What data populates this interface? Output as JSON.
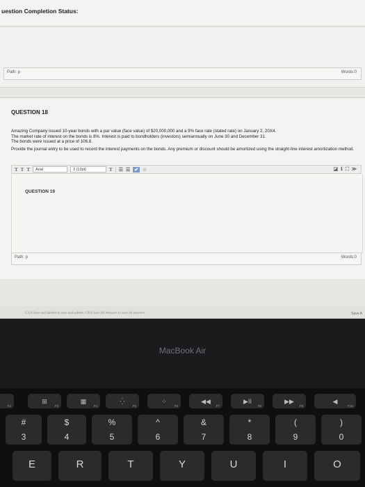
{
  "status": {
    "title": "uestion Completion Status:"
  },
  "editor1": {
    "path": "Path: p",
    "words": "Words:0"
  },
  "question18": {
    "title": "QUESTION 18",
    "body": [
      "Amazing Company issued 10-year bonds with a par value (face value) of $20,000,000 and a 9% face rate (stated rate) on January 2, 20X4.",
      "The market rate of interest on the bonds is 8%.  Interest is paid to bondholders (investors) semiannually on June 30 and December 31.",
      "The bonds were issued at a price of 106.8."
    ],
    "instruction": "Provide the journal entry to be used to record the interest payments on the bonds.  Any premium or discount should be amortized using the straight-line interest amortization method.",
    "toolbar": {
      "b1": "T",
      "b2": "T",
      "b3": "T",
      "font": "Arial",
      "size": "3 (12pt)",
      "t4": "T",
      "list1": "☰",
      "list2": "☰",
      "check": "✔",
      "link": "⊘",
      "right": [
        "◪",
        "ℹ",
        "⛶",
        "≫"
      ]
    },
    "path": "Path: p",
    "words": "Words:0"
  },
  "question19": {
    "title": "QUESTION 19"
  },
  "footer": {
    "hint": "Click Save and Submit to save and submit. Click Save All Answers to save all answers.",
    "save": "Save A"
  },
  "bezel": {
    "label": "MacBook Air"
  },
  "keyboard": {
    "fn_row": [
      {
        "icon": "",
        "fn": "F2"
      },
      {
        "icon": "⊞",
        "fn": "F3"
      },
      {
        "icon": "▦",
        "fn": "F4"
      },
      {
        "icon": "⁛",
        "fn": "F5"
      },
      {
        "icon": "⁘",
        "fn": "F6"
      },
      {
        "icon": "◀◀",
        "fn": "F7"
      },
      {
        "icon": "▶II",
        "fn": "F8"
      },
      {
        "icon": "▶▶",
        "fn": "F9"
      },
      {
        "icon": "◀",
        "fn": "F10"
      }
    ],
    "num_row": [
      {
        "top": "#",
        "bot": "3"
      },
      {
        "top": "$",
        "bot": "4"
      },
      {
        "top": "%",
        "bot": "5"
      },
      {
        "top": "^",
        "bot": "6"
      },
      {
        "top": "&",
        "bot": "7"
      },
      {
        "top": "*",
        "bot": "8"
      },
      {
        "top": "(",
        "bot": "9"
      },
      {
        "top": ")",
        "bot": "0"
      }
    ],
    "letter_row": [
      "E",
      "R",
      "T",
      "Y",
      "U",
      "I",
      "O"
    ]
  }
}
